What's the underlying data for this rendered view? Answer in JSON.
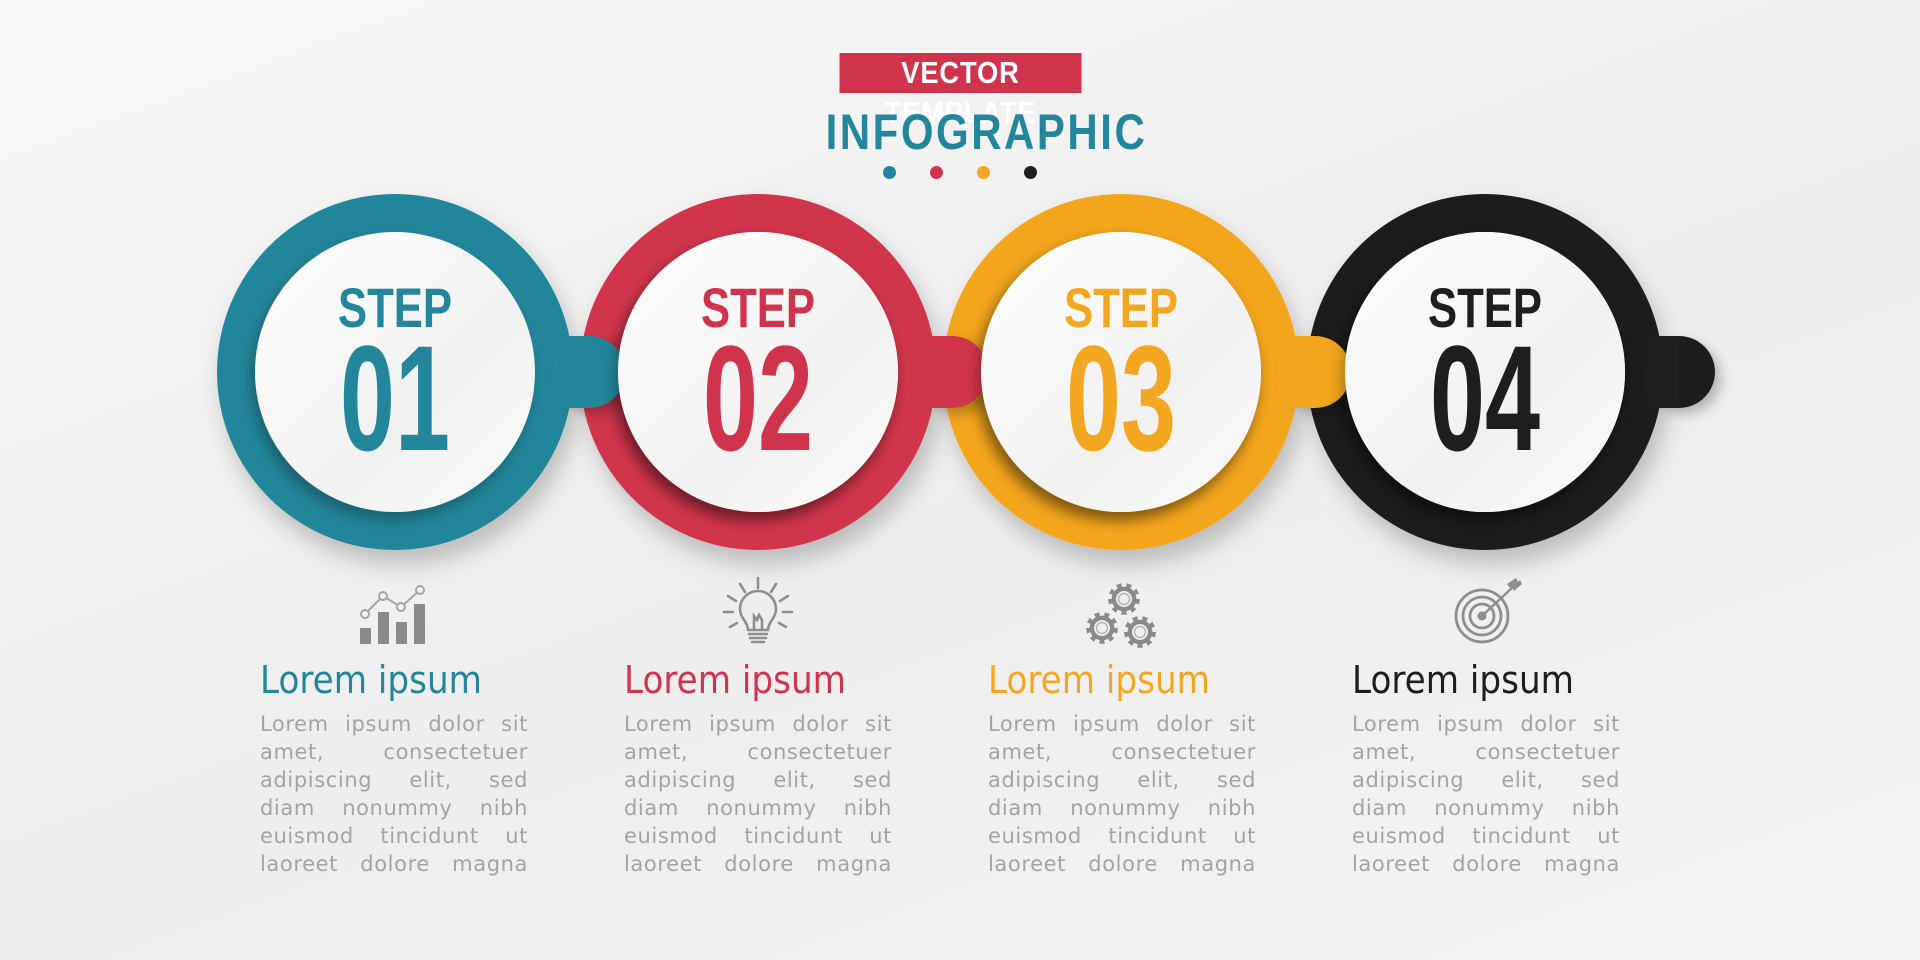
{
  "header": {
    "banner": "VECTOR TEMPLATE",
    "title": "INFOGRAPHIC",
    "dots": [
      "#23869b",
      "#d0344c",
      "#f3a61f",
      "#1e1e1e"
    ]
  },
  "colors": {
    "teal": "#23869b",
    "red": "#d0344c",
    "orange": "#f3a61f",
    "black": "#1e1e1e",
    "body_text": "#a3a3a3"
  },
  "steps": [
    {
      "label": "STEP",
      "number": "01",
      "color": "#23869b",
      "icon": "bar-chart-icon",
      "title": "Lorem ipsum",
      "body": [
        "Lorem ipsum dolor sit",
        "amet, consectetuer",
        "adipiscing elit, sed",
        "diam nonummy nibh",
        "euismod tincidunt ut",
        "laoreet dolore magna"
      ]
    },
    {
      "label": "STEP",
      "number": "02",
      "color": "#d0344c",
      "icon": "lightbulb-icon",
      "title": "Lorem ipsum",
      "body": [
        "Lorem ipsum dolor sit",
        "amet, consectetuer",
        "adipiscing elit, sed",
        "diam nonummy nibh",
        "euismod tincidunt ut",
        "laoreet dolore magna"
      ]
    },
    {
      "label": "STEP",
      "number": "03",
      "color": "#f3a61f",
      "icon": "gears-icon",
      "title": "Lorem ipsum",
      "body": [
        "Lorem ipsum dolor sit",
        "amet, consectetuer",
        "adipiscing elit, sed",
        "diam nonummy nibh",
        "euismod tincidunt ut",
        "laoreet dolore magna"
      ]
    },
    {
      "label": "STEP",
      "number": "04",
      "color": "#1e1e1e",
      "icon": "target-icon",
      "title": "Lorem ipsum",
      "body": [
        "Lorem ipsum dolor sit",
        "amet, consectetuer",
        "adipiscing elit, sed",
        "diam nonummy nibh",
        "euismod tincidunt ut",
        "laoreet dolore magna"
      ]
    }
  ]
}
